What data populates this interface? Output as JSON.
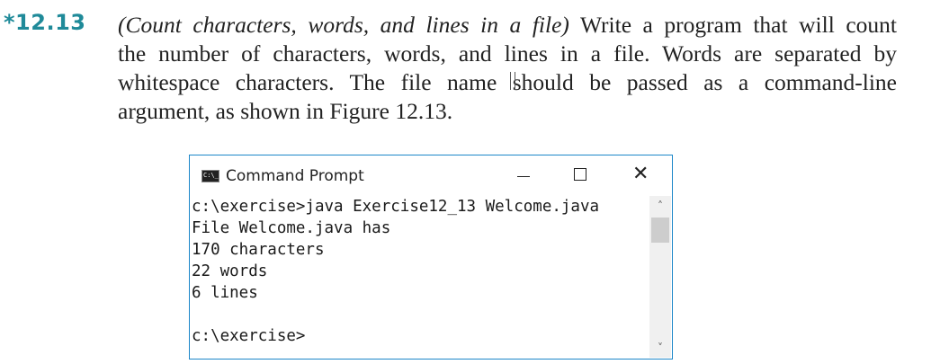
{
  "exercise": {
    "number": "*12.13",
    "title": "(Count characters, words, and lines in a file)",
    "lines": [
      " Write a program that will count",
      "the number of characters, words, and lines in a file. Words are separated by",
      "whitespace characters. The file name ",
      "should be passed as a command-line",
      "argument, as shown in Figure 12.13."
    ]
  },
  "console": {
    "title": "Command Prompt",
    "icon": "cmd-icon",
    "lines": [
      "c:\\exercise>java Exercise12_13 Welcome.java",
      "File Welcome.java has",
      "170 characters",
      "22 words",
      "6 lines",
      "",
      "c:\\exercise>"
    ],
    "controls": {
      "minimize": "minimize-icon",
      "maximize": "maximize-icon",
      "close": "✕"
    }
  }
}
